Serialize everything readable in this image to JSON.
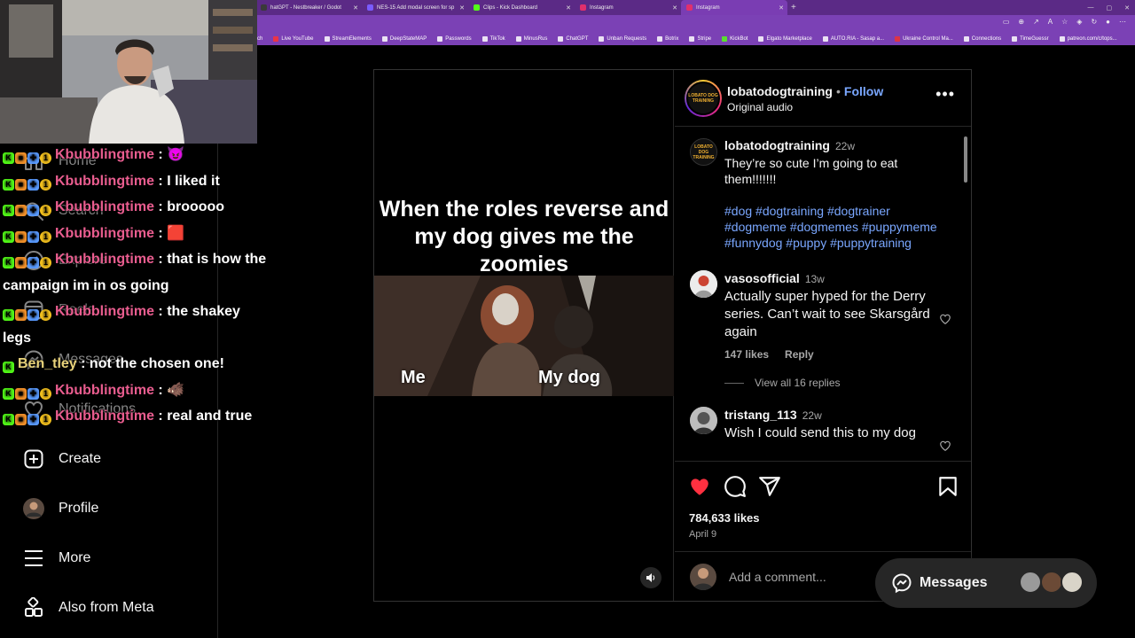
{
  "browser": {
    "tabs": [
      {
        "label": "hatGPT - Nestbreaker / Godot",
        "color": "#3a3a3a"
      },
      {
        "label": "NES-15 Add modal screen for sp",
        "color": "#7a5cff"
      },
      {
        "label": "Clips - Kick Dashboard",
        "color": "#53fc18"
      },
      {
        "label": "Instagram",
        "color": "#e1306c"
      },
      {
        "label": "Instagram",
        "color": "#e1306c"
      }
    ],
    "new_tab": "+",
    "bookmarks": [
      "ch",
      "Live YouTube",
      "StreamElements",
      "DeepStateMAP",
      "Passwords",
      "TikTok",
      "MinusRus",
      "ChatGPT",
      "Unban Requests",
      "Botrix",
      "Stripe",
      "KickBot",
      "Elgato Marketplace",
      "AUTO.RIA - Sasap a...",
      "Ukraine Control Ma...",
      "Connections",
      "TimeGuessr",
      "patreon.com/c/tops..."
    ]
  },
  "nav": {
    "items": [
      {
        "label": "Home",
        "icon": "home-icon"
      },
      {
        "label": "Search",
        "icon": "search-icon"
      },
      {
        "label": "Explore",
        "icon": "compass-icon"
      },
      {
        "label": "Reels",
        "icon": "reels-icon"
      },
      {
        "label": "Messages",
        "icon": "messenger-icon"
      },
      {
        "label": "Notifications",
        "icon": "heart-icon"
      },
      {
        "label": "Create",
        "icon": "plus-square-icon"
      },
      {
        "label": "Profile",
        "icon": "avatar"
      },
      {
        "label": "More",
        "icon": "menu-icon"
      },
      {
        "label": "Also from Meta",
        "icon": "meta-apps-icon"
      }
    ]
  },
  "chat": {
    "lines": [
      {
        "user": "Kbubblingtime",
        "sep": " : ",
        "text": "",
        "emote": "😈"
      },
      {
        "user": "Kbubblingtime",
        "sep": " : ",
        "text": "I liked it",
        "emote": ""
      },
      {
        "user": "Kbubblingtime",
        "sep": " : ",
        "text": "brooooo",
        "emote": ""
      },
      {
        "user": "Kbubblingtime",
        "sep": " : ",
        "text": "",
        "emote": "🟥"
      },
      {
        "user": "Kbubblingtime",
        "sep": " : ",
        "text": "that is how the campaign im in os going",
        "emote": ""
      },
      {
        "user": "Kbubblingtime",
        "sep": " : ",
        "text": "the shakey legs",
        "emote": ""
      },
      {
        "user": "Ben_tley",
        "sep": " : ",
        "text": "not the chosen one!",
        "emote": ""
      },
      {
        "user": "Kbubblingtime",
        "sep": " : ",
        "text": "",
        "emote": "🐗"
      },
      {
        "user": "Kbubblingtime",
        "sep": " : ",
        "text": "real and true",
        "emote": ""
      }
    ],
    "badge_k": "K",
    "badge_coin": "1"
  },
  "post": {
    "author": "lobatodogtraining",
    "separator": "•",
    "follow_label": "Follow",
    "audio": "Original audio",
    "more_label": "•••",
    "avatar_text": "LOBATO DOG TRAINING",
    "media": {
      "title": "When the roles reverse and my dog gives me the zoomies",
      "caption_left": "Me",
      "caption_right": "My dog"
    },
    "caption": {
      "user": "lobatodogtraining",
      "time": "22w",
      "text": "They’re so cute I’m going to eat them!!!!!!!",
      "hashtags": "#dog #dogtraining #dogtrainer #dogmeme #dogmemes #puppymeme #funnydog #puppy #puppytraining"
    },
    "comments": [
      {
        "user": "vasosofficial",
        "time": "13w",
        "text": "Actually super hyped for the Derry series. Can’t wait to see Skarsgård again",
        "likes": "147 likes",
        "reply": "Reply",
        "view_replies": "View all 16 replies"
      },
      {
        "user": "tristang_113",
        "time": "22w",
        "text": "Wish I could send this to my dog"
      }
    ],
    "likes": "784,633 likes",
    "date": "April 9",
    "add_comment_placeholder": "Add a comment..."
  },
  "messages_pill": {
    "label": "Messages"
  },
  "colors": {
    "accent_link": "#7aa7ff",
    "like_red": "#ff3040",
    "browser_purple": "#7b41b5",
    "chat_user": "#e95d8f"
  }
}
